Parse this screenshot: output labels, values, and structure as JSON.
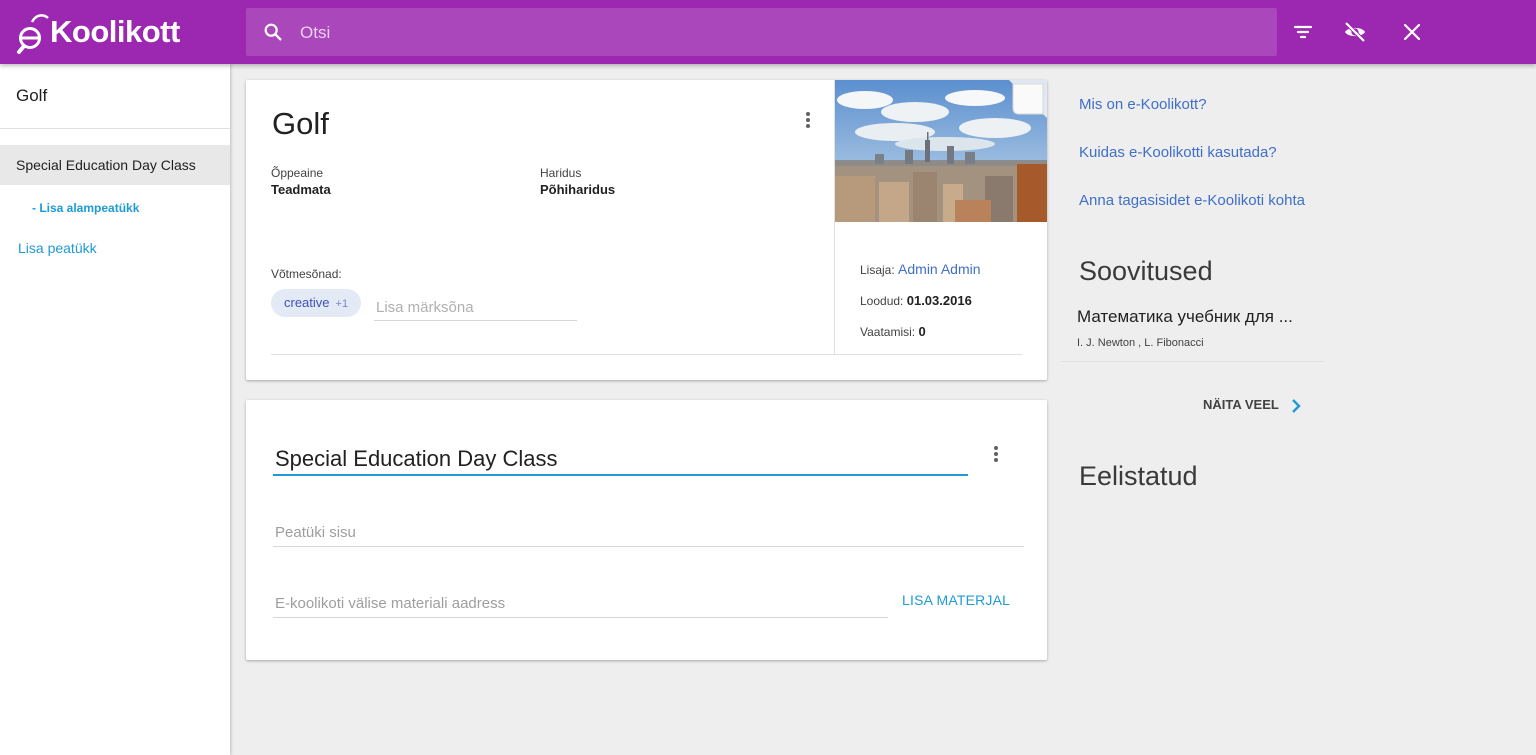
{
  "app": {
    "logo_text": "Koolikott",
    "logo_letter": "e"
  },
  "search": {
    "placeholder": "Otsi",
    "value": ""
  },
  "toolbar": {
    "filter_icon": "filter-icon",
    "hide_icon": "visibility-off-icon",
    "close_icon": "close-icon"
  },
  "sidebar": {
    "title": "Golf",
    "chapter": "Special Education Day Class",
    "add_subchapter": "- Lisa alampeatükk",
    "add_chapter": "Lisa peatükk"
  },
  "card": {
    "title": "Golf",
    "subject_label": "Õppeaine",
    "subject_value": "Teadmata",
    "education_label": "Haridus",
    "education_value": "Põhiharidus",
    "keywords_label": "Võtmesõnad:",
    "keyword_chip": "creative",
    "keyword_more": "+1",
    "keyword_placeholder": "Lisa märksõna",
    "added_by_label": "Lisaja:",
    "added_by_value": "Admin Admin",
    "created_label": "Loodud:",
    "created_value": "01.03.2016",
    "views_label": "Vaatamisi:",
    "views_value": "0"
  },
  "chapter_card": {
    "title": "Special Education Day Class",
    "content_placeholder": "Peatüki sisu",
    "url_placeholder": "E-koolikoti välise materiali aadress",
    "add_material": "LISA MATERJAL"
  },
  "right": {
    "links": [
      "Mis on e-Koolikott?",
      "Kuidas e-Koolikotti kasutada?",
      "Anna tagasisidet e-Koolikoti kohta"
    ],
    "recommendations_heading": "Soovitused",
    "recommendation_title": "Математика учебник для ...",
    "recommendation_authors": "I. J. Newton , L. Fibonacci",
    "show_more": "NÄITA VEEL",
    "favorites_heading": "Eelistatud"
  },
  "colors": {
    "brand": "#9c27b0",
    "accent": "#1e9ad6",
    "link": "#3f6fc8"
  }
}
